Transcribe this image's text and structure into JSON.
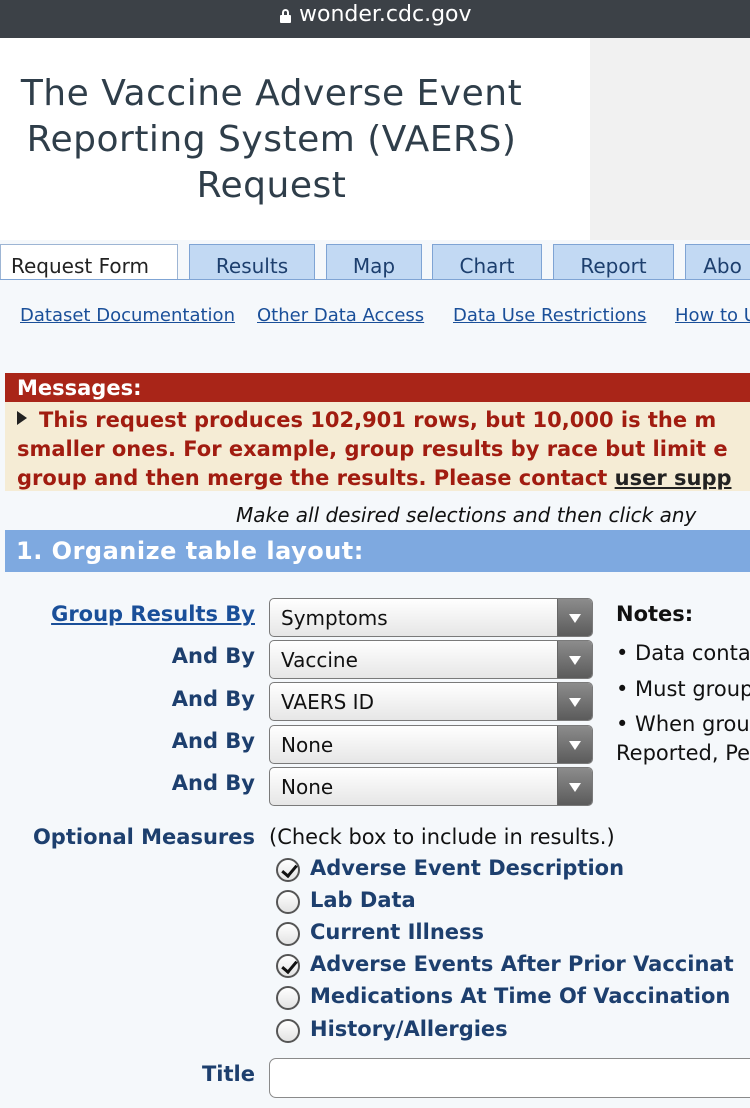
{
  "browser": {
    "url": "wonder.cdc.gov"
  },
  "header": {
    "title_line1": "The Vaccine Adverse Event",
    "title_line2": "Reporting System (VAERS)",
    "title_line3": "Request"
  },
  "tabs": [
    {
      "label": "Request Form"
    },
    {
      "label": "Results"
    },
    {
      "label": "Map"
    },
    {
      "label": "Chart"
    },
    {
      "label": "Report"
    },
    {
      "label": "Abo"
    }
  ],
  "links": [
    {
      "label": "Dataset Documentation"
    },
    {
      "label": "Other Data Access"
    },
    {
      "label": "Data Use Restrictions"
    },
    {
      "label": "How to U"
    }
  ],
  "messages": {
    "heading": "Messages:",
    "line1": "This request produces 102,901 rows, but 10,000 is the m",
    "line2": "smaller ones. For example, group results by race but limit e",
    "line3_text": "group and then merge the results. Please contact ",
    "line3_link": "user supp"
  },
  "instructions": "Make all desired selections and then click any",
  "section1": {
    "heading": "1. Organize table layout:",
    "group_label": "Group Results By",
    "and_by_label": "And By",
    "selects": [
      {
        "value": "Symptoms"
      },
      {
        "value": "Vaccine"
      },
      {
        "value": "VAERS ID"
      },
      {
        "value": "None"
      },
      {
        "value": "None"
      }
    ],
    "notes": {
      "title": "Notes:",
      "items": [
        "• Data conta",
        "• Must group",
        "• When grou",
        "Reported, Pe"
      ]
    },
    "optional": {
      "label": "Optional Measures",
      "hint": "(Check box to include in results.)",
      "items": [
        {
          "label": "Adverse Event Description",
          "checked": true
        },
        {
          "label": "Lab Data",
          "checked": false
        },
        {
          "label": "Current Illness",
          "checked": false
        },
        {
          "label": "Adverse Events After Prior Vaccinat",
          "checked": true
        },
        {
          "label": "Medications At Time Of Vaccination",
          "checked": false
        },
        {
          "label": "History/Allergies",
          "checked": false
        }
      ]
    },
    "title_label": "Title",
    "title_value": ""
  }
}
